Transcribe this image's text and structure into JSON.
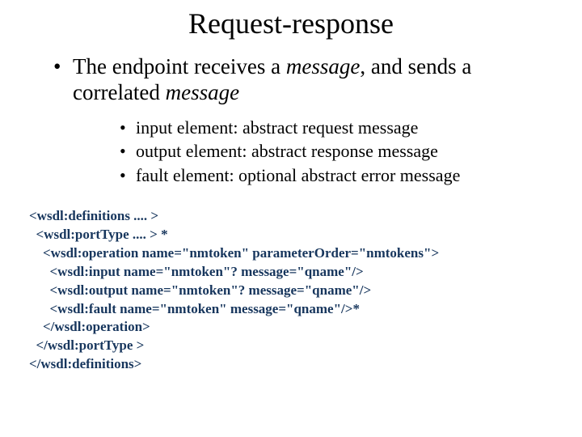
{
  "title": "Request-response",
  "main_bullet": {
    "prefix": "The endpoint receives a ",
    "italic1": "message",
    "mid": ", and sends a correlated ",
    "italic2": "message"
  },
  "sub_bullets": [
    "input element: abstract request message",
    "output element: abstract response message",
    "fault element:  optional abstract error message"
  ],
  "code": "<wsdl:definitions .... >\n  <wsdl:portType .... > *\n    <wsdl:operation name=\"nmtoken\" parameterOrder=\"nmtokens\">\n      <wsdl:input name=\"nmtoken\"? message=\"qname\"/>\n      <wsdl:output name=\"nmtoken\"? message=\"qname\"/>\n      <wsdl:fault name=\"nmtoken\" message=\"qname\"/>*\n    </wsdl:operation>\n  </wsdl:portType >\n</wsdl:definitions>"
}
